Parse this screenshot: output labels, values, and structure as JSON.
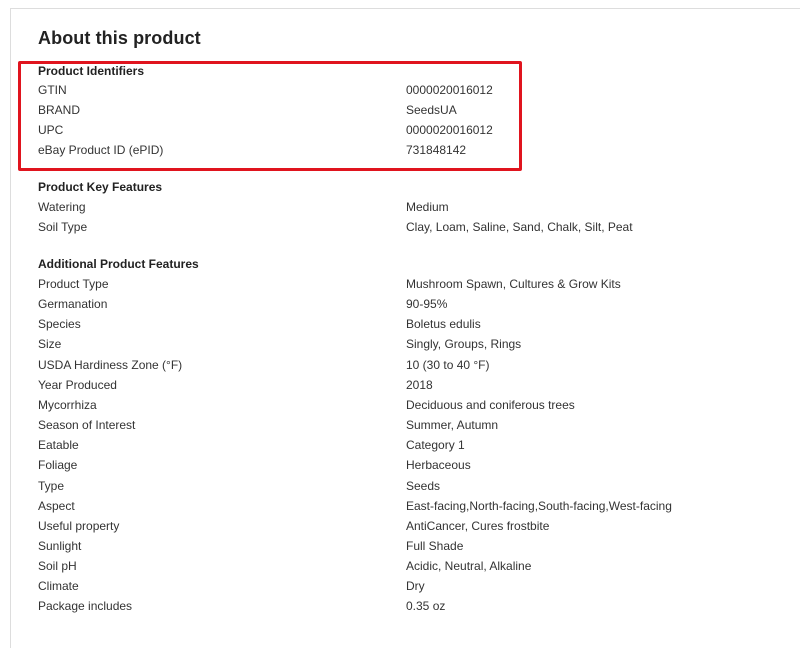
{
  "page": {
    "title": "About this product"
  },
  "sections": {
    "identifiers": {
      "title": "Product Identifiers",
      "rows": [
        {
          "label": "GTIN",
          "value": "0000020016012"
        },
        {
          "label": "BRAND",
          "value": "SeedsUA"
        },
        {
          "label": "UPC",
          "value": "0000020016012"
        },
        {
          "label": "eBay Product ID (ePID)",
          "value": "731848142"
        }
      ]
    },
    "key_features": {
      "title": "Product Key Features",
      "rows": [
        {
          "label": "Watering",
          "value": "Medium"
        },
        {
          "label": "Soil Type",
          "value": "Clay, Loam, Saline, Sand, Chalk, Silt, Peat"
        }
      ]
    },
    "additional": {
      "title": "Additional Product Features",
      "rows": [
        {
          "label": "Product Type",
          "value": "Mushroom Spawn, Cultures & Grow Kits"
        },
        {
          "label": "Germanation",
          "value": "90-95%"
        },
        {
          "label": "Species",
          "value": "Boletus edulis"
        },
        {
          "label": "Size",
          "value": "Singly, Groups, Rings"
        },
        {
          "label": "USDA Hardiness Zone (°F)",
          "value": "10 (30 to 40 °F)"
        },
        {
          "label": "Year Produced",
          "value": "2018"
        },
        {
          "label": "Mycorrhiza",
          "value": "Deciduous and coniferous trees"
        },
        {
          "label": "Season of Interest",
          "value": "Summer, Autumn"
        },
        {
          "label": "Eatable",
          "value": "Category 1"
        },
        {
          "label": "Foliage",
          "value": "Herbaceous"
        },
        {
          "label": "Type",
          "value": "Seeds"
        },
        {
          "label": "Aspect",
          "value": "East-facing,North-facing,South-facing,West-facing"
        },
        {
          "label": "Useful property",
          "value": "AntiCancer, Cures frostbite"
        },
        {
          "label": "Sunlight",
          "value": "Full Shade"
        },
        {
          "label": "Soil pH",
          "value": "Acidic, Neutral, Alkaline"
        },
        {
          "label": "Climate",
          "value": "Dry"
        },
        {
          "label": "Package includes",
          "value": "0.35 oz"
        }
      ]
    }
  },
  "colors": {
    "highlight": "#e0141e",
    "text": "#333333",
    "heading": "#222222",
    "border": "#dddddd"
  }
}
